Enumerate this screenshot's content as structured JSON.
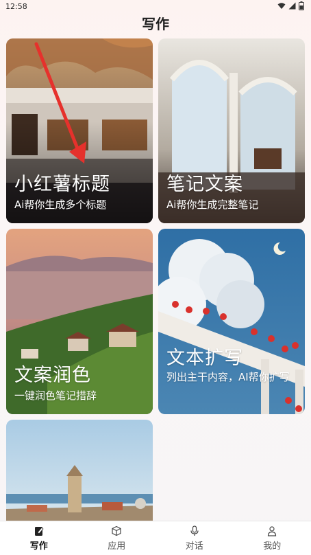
{
  "status_bar": {
    "time": "12:58",
    "icons": [
      "wifi-icon",
      "signal-icon",
      "battery-icon"
    ]
  },
  "header": {
    "title": "写作"
  },
  "cards": [
    {
      "id": "xhs-title",
      "title": "小红薯标题",
      "subtitle": "Ai帮你生成多个标题",
      "scene": "tram-at-sunset"
    },
    {
      "id": "note-copy",
      "title": "笔记文案",
      "subtitle": "Ai帮你生成完整笔记",
      "scene": "palace-arcade"
    },
    {
      "id": "copy-polish",
      "title": "文案润色",
      "subtitle": "一键润色笔记措辞",
      "scene": "lakeside-vineyard"
    },
    {
      "id": "text-expand",
      "title": "文本扩写",
      "subtitle": "列出主干内容，AI帮你扩写",
      "scene": "flowers-clouds-moon"
    },
    {
      "id": "coastal-town",
      "title": "",
      "subtitle": "",
      "scene": "coastal-town"
    }
  ],
  "bottom_nav": [
    {
      "label": "写作",
      "icon": "pen-note-icon",
      "active": true
    },
    {
      "label": "应用",
      "icon": "cube-icon",
      "active": false
    },
    {
      "label": "对话",
      "icon": "microphone-icon",
      "active": false
    },
    {
      "label": "我的",
      "icon": "person-icon",
      "active": false
    }
  ]
}
